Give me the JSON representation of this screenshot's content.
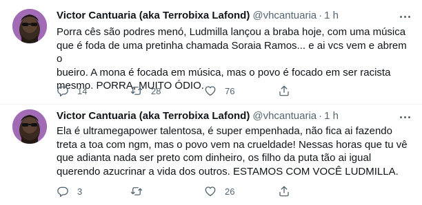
{
  "tweets": [
    {
      "author_name": "Victor Cantuaria (aka Terrobixa Lafond)",
      "handle": "@vhcantuaria",
      "separator": "·",
      "time": "1 h",
      "lines": [
        "Porra cês são podres menó, Ludmilla lançou a braba hoje, com uma música",
        "que é foda de uma pretinha chamada Soraia Ramos... e ai vcs vem e abrem o",
        "bueiro. A mona é focada em música, mas o povo é focado em ser racista",
        "mesmo. PORRA, MUITO ÓDIO."
      ],
      "replies": "14",
      "retweets": "28",
      "likes": "76"
    },
    {
      "author_name": "Victor Cantuaria (aka Terrobixa Lafond)",
      "handle": "@vhcantuaria",
      "separator": "·",
      "time": "1 h",
      "lines": [
        "Ela é ultramegapower talentosa, é super empenhada, não fica ai fazendo",
        "treta a toa com ngm, mas o povo vem na crueldade! Nessas horas que tu vê",
        "que adianta nada ser preto com dinheiro, os filho da puta tão ai igual",
        "querendo azucrinar a vida dos outros. ESTAMOS COM VOCÊ LUDMILLA."
      ],
      "replies": "3",
      "retweets": "",
      "likes": "26"
    }
  ],
  "icons": {
    "reply": "reply-icon",
    "retweet": "retweet-icon",
    "like": "heart-icon",
    "share": "share-icon",
    "more": "more-options-icon"
  },
  "colors": {
    "text": "#0f1419",
    "secondary": "#536471",
    "avatar_bg": "#a26bb6",
    "divider": "#eff3f4"
  }
}
